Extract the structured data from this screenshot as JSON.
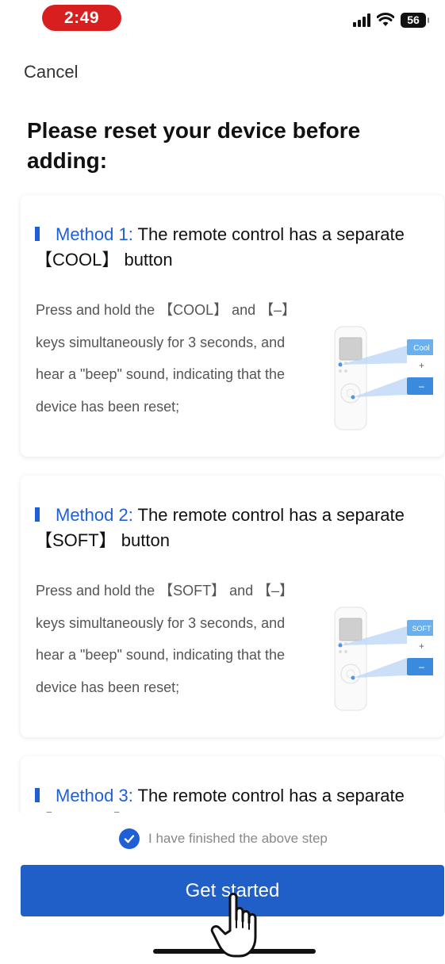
{
  "status_bar": {
    "time": "2:49",
    "battery": "56"
  },
  "header": {
    "cancel": "Cancel",
    "title": "Please reset your device before adding:"
  },
  "methods": [
    {
      "label": "Method 1:",
      "title": " The remote control has a separate 【COOL】 button",
      "body": "Press and hold the 【COOL】 and 【–】 keys simultaneously for 3 seconds, and hear a \"beep\" sound, indicating that the device has been reset;",
      "key_label": "Cool",
      "minus_label": "–",
      "plus_label": "+"
    },
    {
      "label": "Method 2:",
      "title": " The remote control has a separate 【SOFT】 button",
      "body": "Press and hold the 【SOFT】 and 【–】 keys simultaneously for 3 seconds, and hear a \"beep\" sound, indicating that the device has been reset;",
      "key_label": "SOFT",
      "minus_label": "–",
      "plus_label": "+"
    },
    {
      "label": "Method 3:",
      "title": " The remote control has a separate 【TURBO】 button"
    }
  ],
  "footer": {
    "confirm_text": "I have finished the above step",
    "confirm_checked": true,
    "cta_label": "Get started"
  },
  "colors": {
    "accent": "#1f5fd6",
    "time_pill": "#d81f1f",
    "cta": "#215fc8"
  }
}
